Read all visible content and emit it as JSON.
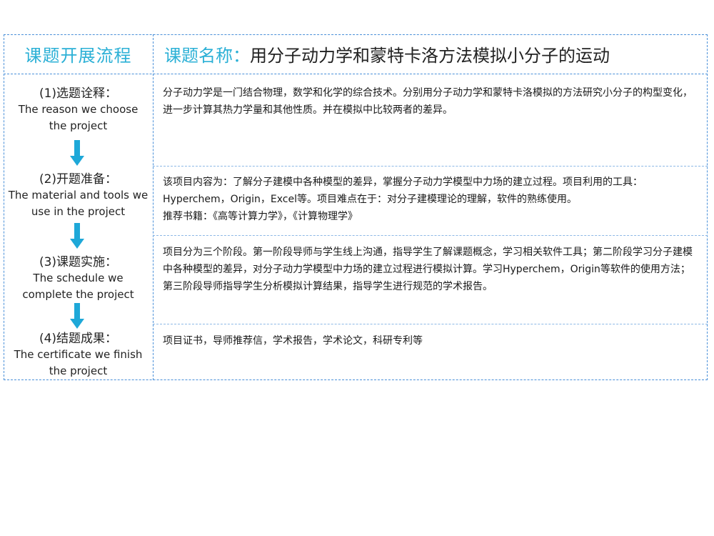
{
  "header": {
    "left_title": "课题开展流程",
    "title_label": "课题名称",
    "title_sep": "：",
    "title_text": "用分子动力学和蒙特卡洛方法模拟小分子的运动"
  },
  "steps": [
    {
      "cn": "(1)选题诠释：",
      "en": "The reason we choose\nthe project",
      "content": [
        "分子动力学是一门结合物理，数学和化学的综合技术。分别用分子动力学和蒙特卡洛模拟的方法研究小分子的构型变化，进一步计算其热力学量和其他性质。并在模拟中比较两者的差异。"
      ]
    },
    {
      "cn": "(2)开题准备：",
      "en": "The material and tools we\nuse in the project",
      "content": [
        "该项目内容为：了解分子建模中各种模型的差异，掌握分子动力学模型中力场的建立过程。项目利用的工具：Hyperchem，Origin，Excel等。项目难点在于：对分子建模理论的理解，软件的熟练使用。",
        "推荐书籍：《高等计算力学》，《计算物理学》"
      ]
    },
    {
      "cn": "(3)课题实施：",
      "en": "The schedule we\ncomplete the project",
      "content": [
        "项目分为三个阶段。第一阶段导师与学生线上沟通，指导学生了解课题概念，学习相关软件工具；第二阶段学习分子建模中各种模型的差异，对分子动力学模型中力场的建立过程进行模拟计算。学习Hyperchem，Origin等软件的使用方法；第三阶段导师指导学生分析模拟计算结果，指导学生进行规范的学术报告。"
      ]
    },
    {
      "cn": "(4)结题成果：",
      "en": "The certificate we finish\nthe project",
      "content": [
        "项目证书，导师推荐信，学术报告，学术论文，科研专利等"
      ]
    }
  ],
  "colors": {
    "accent": "#2bb0d6",
    "border": "#4a90d9",
    "arrow": "#1ea8d8"
  }
}
